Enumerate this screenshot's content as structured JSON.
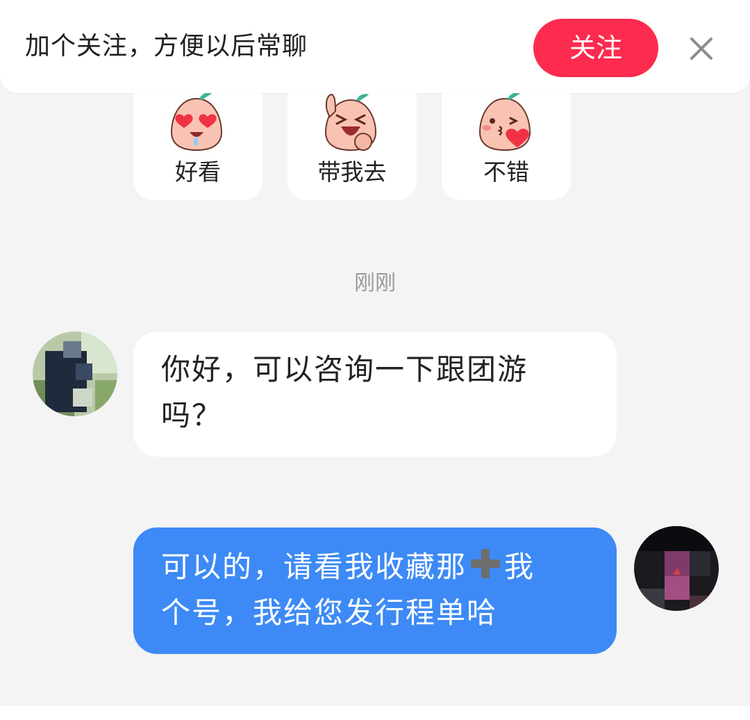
{
  "banner": {
    "text": "加个关注，方便以后常聊",
    "follow_label": "关注",
    "close_icon": "close-icon"
  },
  "stickers": [
    {
      "label": "好看",
      "icon": "heart-eyes-face-icon"
    },
    {
      "label": "带我去",
      "icon": "excited-face-icon"
    },
    {
      "label": "不错",
      "icon": "kiss-heart-face-icon"
    }
  ],
  "chat": {
    "timestamp": "刚刚",
    "messages": [
      {
        "side": "left",
        "line1": "你好，可以咨询一下跟团游",
        "line2": "吗？"
      },
      {
        "side": "right",
        "line1_prefix": "可以的，请看我收藏那",
        "line1_suffix": "我",
        "line2": "个号，我给您发行程单哈"
      }
    ]
  },
  "colors": {
    "accent": "#fd2b4f",
    "sent_bubble": "#3d8af6",
    "background": "#f4f4f4"
  }
}
